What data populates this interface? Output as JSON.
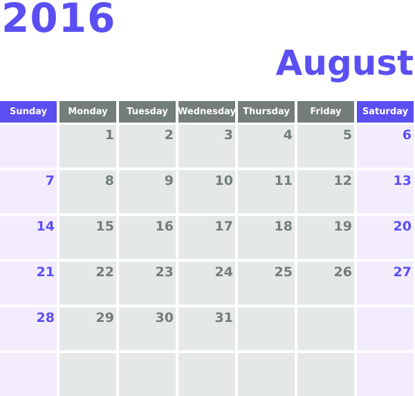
{
  "year": "2016",
  "month": "August",
  "colors": {
    "accent": "#5b4ff2",
    "header_gray": "#737d7a",
    "weekday_cell": "#e4e8e8",
    "weekend_cell": "#f2ecfd"
  },
  "weekdays": [
    "Sunday",
    "Monday",
    "Tuesday",
    "Wednesday",
    "Thursday",
    "Friday",
    "Saturday"
  ],
  "weeks": [
    [
      "",
      "1",
      "2",
      "3",
      "4",
      "5",
      "6"
    ],
    [
      "7",
      "8",
      "9",
      "10",
      "11",
      "12",
      "13"
    ],
    [
      "14",
      "15",
      "16",
      "17",
      "18",
      "19",
      "20"
    ],
    [
      "21",
      "22",
      "23",
      "24",
      "25",
      "26",
      "27"
    ],
    [
      "28",
      "29",
      "30",
      "31",
      "",
      "",
      ""
    ],
    [
      "",
      "",
      "",
      "",
      "",
      "",
      ""
    ]
  ]
}
